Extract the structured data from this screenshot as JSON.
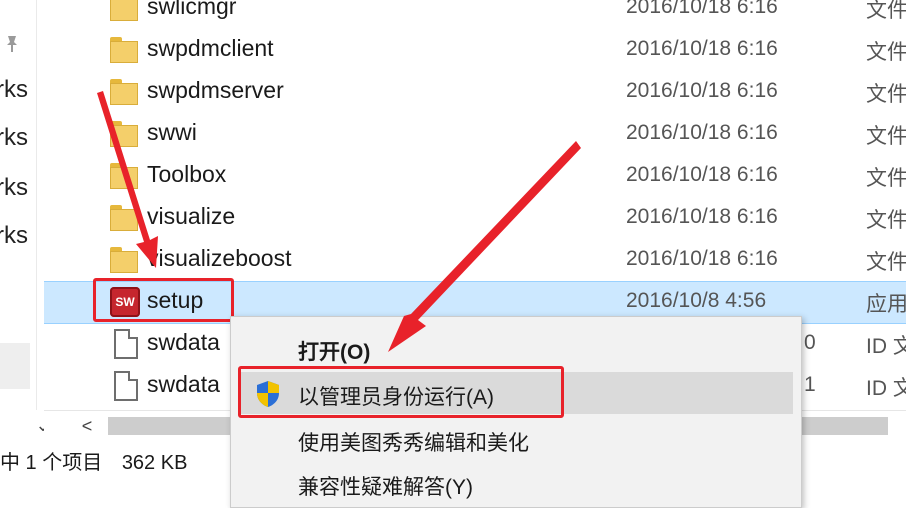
{
  "nav": {
    "items": [
      "rks",
      "rks",
      "rks",
      "rks"
    ]
  },
  "files": [
    {
      "name": "swlicmgr",
      "date": "2016/10/18 6:16",
      "type": "文件",
      "icon": "folder-icon"
    },
    {
      "name": "swpdmclient",
      "date": "2016/10/18 6:16",
      "type": "文件",
      "icon": "folder-icon"
    },
    {
      "name": "swpdmserver",
      "date": "2016/10/18 6:16",
      "type": "文件",
      "icon": "folder-icon"
    },
    {
      "name": "swwi",
      "date": "2016/10/18 6:16",
      "type": "文件",
      "icon": "folder-icon"
    },
    {
      "name": "Toolbox",
      "date": "2016/10/18 6:16",
      "type": "文件",
      "icon": "folder-icon"
    },
    {
      "name": "visualize",
      "date": "2016/10/18 6:16",
      "type": "文件",
      "icon": "folder-icon"
    },
    {
      "name": "visualizeboost",
      "date": "2016/10/18 6:16",
      "type": "文件",
      "icon": "folder-icon"
    },
    {
      "name": "setup",
      "date": "2016/10/8 4:56",
      "type": "应用",
      "icon": "solidworks-app-icon",
      "icon_text": "SW",
      "selected": true
    },
    {
      "name": "swdata",
      "date": "0",
      "type": "ID 文",
      "icon": "document-icon"
    },
    {
      "name": "swdata",
      "date": "1",
      "type": "ID 文",
      "icon": "document-icon"
    }
  ],
  "status": {
    "selected": "中 1 个项目",
    "size": "362 KB"
  },
  "context_menu": {
    "items": [
      {
        "label": "打开(O)",
        "bold": true
      },
      {
        "label": "以管理员身份运行(A)",
        "icon": "uac-shield-icon",
        "highlighted": true
      },
      {
        "label": "使用美图秀秀编辑和美化"
      },
      {
        "label": "兼容性疑难解答(Y)"
      }
    ]
  },
  "colors": {
    "selection": "#cce8ff",
    "highlight_red": "#e8222a",
    "folder": "#f4cf6a"
  }
}
